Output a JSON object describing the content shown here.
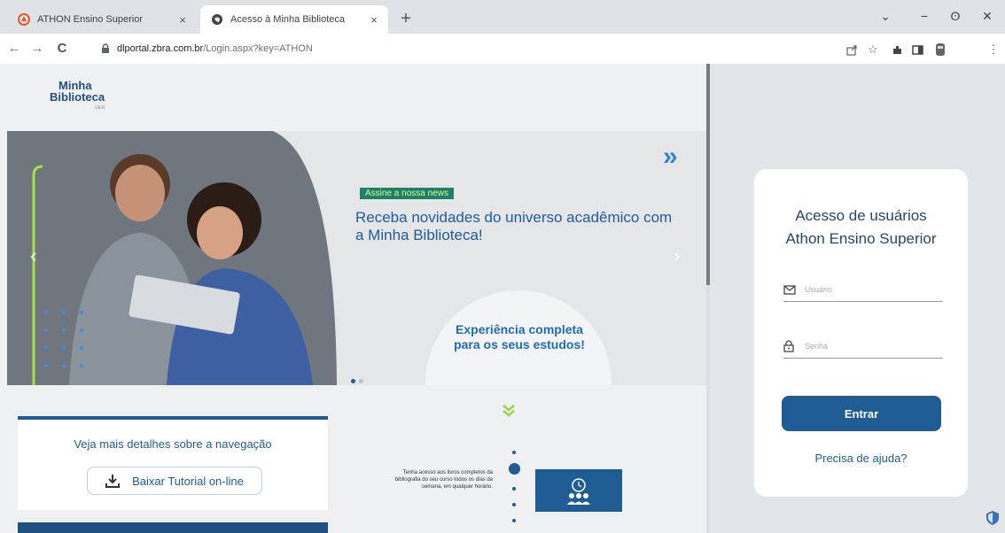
{
  "browser": {
    "tabs": [
      {
        "title": "ATHON Ensino Superior",
        "favicon": "athon-logo-icon"
      },
      {
        "title": "Acesso à Minha Biblioteca",
        "favicon": "globe-icon"
      }
    ],
    "new_tab_symbol": "+",
    "close_symbol": "×",
    "window_controls": {
      "minimize": "−",
      "restore": "ʘ",
      "close": "✕",
      "tab_search": "⌄"
    },
    "nav": {
      "back": "←",
      "forward": "→",
      "reload": "C"
    },
    "url_host": "dlportal.zbra.com.br",
    "url_path": "/Login.aspx?key=ATHON",
    "toolbar_icons": [
      "share-icon",
      "bookmark-star-icon",
      "extensions-icon",
      "sidebar-icon",
      "profile-icon",
      "menu-icon"
    ]
  },
  "logo": {
    "line1": "Minha",
    "line2": "Biblioteca",
    "sub": "GEN"
  },
  "banner": {
    "badge": "Assine a nossa news",
    "headline": "Receba novidades do universo acadêmico com a Minha Biblioteca!",
    "arrows": "»",
    "experience": "Experiência completa para os seus estudos!",
    "prev": "‹",
    "next": "›"
  },
  "navigation_box": {
    "title": "Veja mais detalhes sobre a navegação",
    "button_label": "Baixar Tutorial on-line"
  },
  "timeline": {
    "text": "Tenha acesso aos livros completos da bibliografia do seu curso todos os dias da semana, em qualquer horário."
  },
  "login": {
    "title_line1": "Acesso de usuários",
    "title_line2": "Athon Ensino Superior",
    "username_placeholder": "Usuário",
    "password_placeholder": "Senha",
    "submit_label": "Entrar",
    "help_label": "Precisa de ajuda?"
  },
  "colors": {
    "brand": "#1f5c93",
    "accent_green": "#9cd448",
    "headline_blue": "#1f5ca0"
  }
}
